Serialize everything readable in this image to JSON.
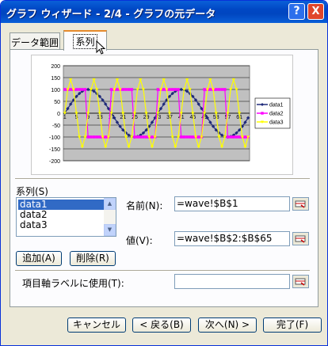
{
  "window": {
    "title": "グラフ ウィザード - 2/4 - グラフの元データ"
  },
  "title_buttons": {
    "help": "?",
    "close": "X"
  },
  "tabs": [
    {
      "label": "データ範囲"
    },
    {
      "label": "系列"
    }
  ],
  "chart_data": {
    "type": "line",
    "x": [
      1,
      2,
      3,
      4,
      5,
      6,
      7,
      8,
      9,
      10,
      11,
      12,
      13,
      14,
      15,
      16,
      17,
      18,
      19,
      20,
      21,
      22,
      23,
      24,
      25,
      26,
      27,
      28,
      29,
      30,
      31,
      32,
      33,
      34,
      35,
      36,
      37,
      38,
      39,
      40,
      41,
      42,
      43,
      44,
      45,
      46,
      47,
      48,
      49,
      50,
      51,
      52,
      53,
      54,
      55,
      56,
      57,
      58,
      59,
      60,
      61,
      62,
      63,
      64
    ],
    "x_tick_labels": [
      "1",
      "5",
      "9",
      "13",
      "17",
      "21",
      "25",
      "29",
      "33",
      "37",
      "41",
      "45",
      "49",
      "53",
      "57",
      "61"
    ],
    "ylim": [
      -200,
      200
    ],
    "y_ticks": [
      "200",
      "150",
      "100",
      "50",
      "0",
      "-50",
      "-100",
      "-150",
      "-200"
    ],
    "legend_placement": "right",
    "series": [
      {
        "name": "data1",
        "color": "#1f2a7a",
        "values": [
          0,
          19.5,
          38.3,
          55.6,
          70.7,
          83.1,
          92.4,
          98.1,
          100,
          98.1,
          92.4,
          83.1,
          70.7,
          55.6,
          38.3,
          19.5,
          0,
          -19.5,
          -38.3,
          -55.6,
          -70.7,
          -83.1,
          -92.4,
          -98.1,
          -100,
          -98.1,
          -92.4,
          -83.1,
          -70.7,
          -55.6,
          -38.3,
          -19.5,
          0,
          19.5,
          38.3,
          55.6,
          70.7,
          83.1,
          92.4,
          98.1,
          100,
          98.1,
          92.4,
          83.1,
          70.7,
          55.6,
          38.3,
          19.5,
          0,
          -19.5,
          -38.3,
          -55.6,
          -70.7,
          -83.1,
          -92.4,
          -98.1,
          -100,
          -98.1,
          -92.4,
          -83.1,
          -70.7,
          -55.6,
          -38.3,
          -19.5
        ]
      },
      {
        "name": "data2",
        "color": "#ff00ff",
        "values": [
          100,
          100,
          100,
          100,
          100,
          100,
          100,
          100,
          -100,
          -100,
          -100,
          -100,
          -100,
          -100,
          -100,
          -100,
          100,
          100,
          100,
          100,
          100,
          100,
          100,
          100,
          -100,
          -100,
          -100,
          -100,
          -100,
          -100,
          -100,
          -100,
          100,
          100,
          100,
          100,
          100,
          100,
          100,
          100,
          -100,
          -100,
          -100,
          -100,
          -100,
          -100,
          -100,
          -100,
          100,
          100,
          100,
          100,
          100,
          100,
          100,
          100,
          -100,
          -100,
          -100,
          -100,
          -100,
          -100,
          -100,
          -100
        ]
      },
      {
        "name": "data3",
        "color": "#ffff00",
        "values": [
          0,
          100.0,
          141.4,
          100.0,
          0,
          -100.0,
          -141.4,
          -100.0,
          0,
          100.0,
          141.4,
          100.0,
          0,
          -100.0,
          -141.4,
          -100.0,
          0,
          100.0,
          141.4,
          100.0,
          0,
          -100.0,
          -141.4,
          -100.0,
          0,
          100.0,
          141.4,
          100.0,
          0,
          -100.0,
          -141.4,
          -100.0,
          0,
          100.0,
          141.4,
          100.0,
          0,
          -100.0,
          -141.4,
          -100.0,
          0,
          100.0,
          141.4,
          100.0,
          0,
          -100.0,
          -141.4,
          -100.0,
          0,
          100.0,
          141.4,
          100.0,
          0,
          -100.0,
          -141.4,
          -100.0,
          0,
          100.0,
          141.4,
          100.0,
          0,
          -100.0,
          -141.4,
          -100.0
        ]
      }
    ]
  },
  "series_section": {
    "label": "系列(S)",
    "items": [
      "data1",
      "data2",
      "data3"
    ],
    "selected": "data1",
    "add_button": "追加(A)",
    "remove_button": "削除(R)"
  },
  "fields": {
    "name_label": "名前(N):",
    "name_value": "=wave!$B$1",
    "values_label": "値(V):",
    "values_value": "=wave!$B$2:$B$65",
    "category_label": "項目軸ラベルに使用(T):",
    "category_value": ""
  },
  "footer": {
    "cancel": "キャンセル",
    "back": "< 戻る(B)",
    "next": "次へ(N) >",
    "finish": "完了(F)"
  }
}
